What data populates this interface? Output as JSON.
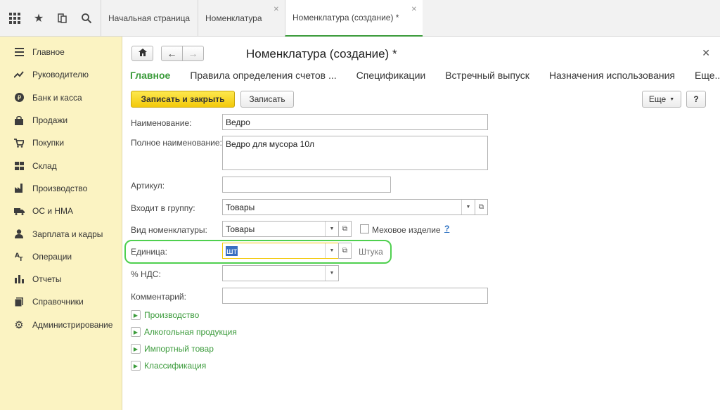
{
  "topbar": {
    "icons": [
      "apps-grid-icon",
      "star-icon",
      "history-icon",
      "search-icon"
    ],
    "tabs": [
      {
        "label": "Начальная страница",
        "active": false
      },
      {
        "label": "Номенклатура",
        "active": false
      },
      {
        "label": "Номенклатура (создание) *",
        "active": true
      }
    ]
  },
  "sidebar": {
    "items": [
      {
        "label": "Главное",
        "icon": "menu-lines-icon"
      },
      {
        "label": "Руководителю",
        "icon": "trend-icon"
      },
      {
        "label": "Банк и касса",
        "icon": "coin-icon"
      },
      {
        "label": "Продажи",
        "icon": "bag-icon"
      },
      {
        "label": "Покупки",
        "icon": "cart-icon"
      },
      {
        "label": "Склад",
        "icon": "warehouse-icon"
      },
      {
        "label": "Производство",
        "icon": "factory-icon"
      },
      {
        "label": "ОС и НМА",
        "icon": "truck-icon"
      },
      {
        "label": "Зарплата и кадры",
        "icon": "person-icon"
      },
      {
        "label": "Операции",
        "icon": "operations-icon"
      },
      {
        "label": "Отчеты",
        "icon": "bar-chart-icon"
      },
      {
        "label": "Справочники",
        "icon": "book-icon"
      },
      {
        "label": "Администрирование",
        "icon": "gear-icon"
      }
    ]
  },
  "form": {
    "title": "Номенклатура (создание) *",
    "tabs": [
      "Главное",
      "Правила определения счетов ...",
      "Спецификации",
      "Встречный выпуск",
      "Назначения использования",
      "Еще..."
    ],
    "buttons": {
      "save_close": "Записать и закрыть",
      "save": "Записать",
      "more": "Еще",
      "help": "?"
    },
    "fields": {
      "name": {
        "label": "Наименование:",
        "value": "Ведро"
      },
      "full_name": {
        "label": "Полное наименование:",
        "value": "Ведро для мусора 10л"
      },
      "article": {
        "label": "Артикул:",
        "value": ""
      },
      "group": {
        "label": "Входит в группу:",
        "value": "Товары"
      },
      "kind": {
        "label": "Вид номенклатуры:",
        "value": "Товары"
      },
      "fur": {
        "label": "Меховое изделие",
        "help": "?"
      },
      "unit": {
        "label": "Единица:",
        "value": "шт",
        "hint": "Штука"
      },
      "vat": {
        "label": "% НДС:",
        "value": ""
      },
      "comment": {
        "label": "Комментарий:",
        "value": ""
      }
    },
    "sections": [
      "Производство",
      "Алкогольная продукция",
      "Импортный товар",
      "Классификация"
    ]
  }
}
